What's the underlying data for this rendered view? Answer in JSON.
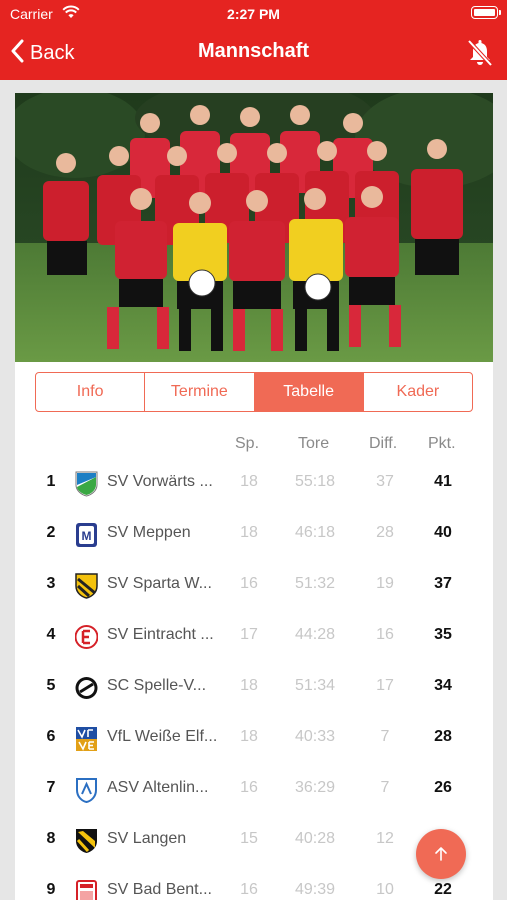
{
  "status_bar": {
    "carrier": "Carrier",
    "time": "2:27 PM"
  },
  "nav": {
    "back_label": "Back",
    "title": "Mannschaft"
  },
  "tabs": [
    {
      "label": "Info",
      "active": false
    },
    {
      "label": "Termine",
      "active": false
    },
    {
      "label": "Tabelle",
      "active": true
    },
    {
      "label": "Kader",
      "active": false
    }
  ],
  "table": {
    "columns": {
      "sp": "Sp.",
      "tore": "Tore",
      "diff": "Diff.",
      "pkt": "Pkt."
    },
    "rows": [
      {
        "rank": "1",
        "team": "SV Vorwärts ...",
        "sp": "18",
        "tore": "55:18",
        "diff": "37",
        "pkt": "41",
        "crest": "sv-vorwaerts-crest"
      },
      {
        "rank": "2",
        "team": "SV Meppen",
        "sp": "18",
        "tore": "46:18",
        "diff": "28",
        "pkt": "40",
        "crest": "sv-meppen-crest"
      },
      {
        "rank": "3",
        "team": "SV Sparta W...",
        "sp": "16",
        "tore": "51:32",
        "diff": "19",
        "pkt": "37",
        "crest": "sv-sparta-crest"
      },
      {
        "rank": "4",
        "team": "SV Eintracht ...",
        "sp": "17",
        "tore": "44:28",
        "diff": "16",
        "pkt": "35",
        "crest": "sv-eintracht-crest"
      },
      {
        "rank": "5",
        "team": "SC Spelle-V...",
        "sp": "18",
        "tore": "51:34",
        "diff": "17",
        "pkt": "34",
        "crest": "sc-spelle-crest"
      },
      {
        "rank": "6",
        "team": "VfL Weiße Elf...",
        "sp": "18",
        "tore": "40:33",
        "diff": "7",
        "pkt": "28",
        "crest": "vfl-weisse-elf-crest"
      },
      {
        "rank": "7",
        "team": "ASV Altenlin...",
        "sp": "16",
        "tore": "36:29",
        "diff": "7",
        "pkt": "26",
        "crest": "asv-altenlingen-crest"
      },
      {
        "rank": "8",
        "team": "SV Langen",
        "sp": "15",
        "tore": "40:28",
        "diff": "12",
        "pkt": "",
        "crest": "sv-langen-crest"
      },
      {
        "rank": "9",
        "team": "SV Bad Bent...",
        "sp": "16",
        "tore": "49:39",
        "diff": "10",
        "pkt": "22",
        "crest": "sv-bad-bentheim-crest"
      }
    ]
  },
  "icons": {
    "back": "chevron-left-icon",
    "notifications": "bell-off-icon",
    "scroll_top": "arrow-up-icon"
  },
  "colors": {
    "brand": "#e52421",
    "accent": "#f06a55"
  }
}
